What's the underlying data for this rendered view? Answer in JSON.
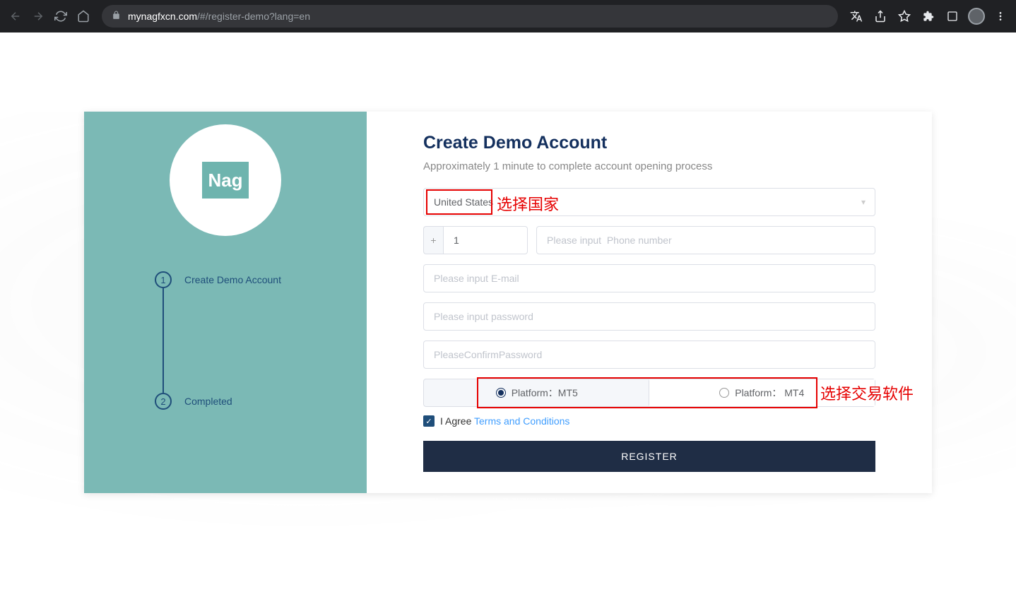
{
  "browser": {
    "url_host": "mynagfxcn.com",
    "url_path": "/#/register-demo?lang=en"
  },
  "sidebar": {
    "logo_text": "Nag",
    "steps": [
      {
        "num": "1",
        "label": "Create Demo Account"
      },
      {
        "num": "2",
        "label": "Completed"
      }
    ]
  },
  "form": {
    "title": "Create Demo Account",
    "subtitle": "Approximately 1 minute to complete account opening process",
    "country_value": "United States",
    "phone_prefix_symbol": "+",
    "phone_prefix_value": "1",
    "phone_placeholder": "Please input  Phone number",
    "email_placeholder": "Please input E-mail",
    "password_placeholder": "Please input password",
    "confirm_placeholder": "PleaseConfirmPassword",
    "platform_mt5": "Platform：MT5",
    "platform_mt4": "Platform： MT4",
    "agree_text": "I Agree ",
    "terms_text": "Terms and Conditions",
    "register_label": "REGISTER"
  },
  "annotations": {
    "country": "选择国家",
    "platform": "选择交易软件"
  }
}
